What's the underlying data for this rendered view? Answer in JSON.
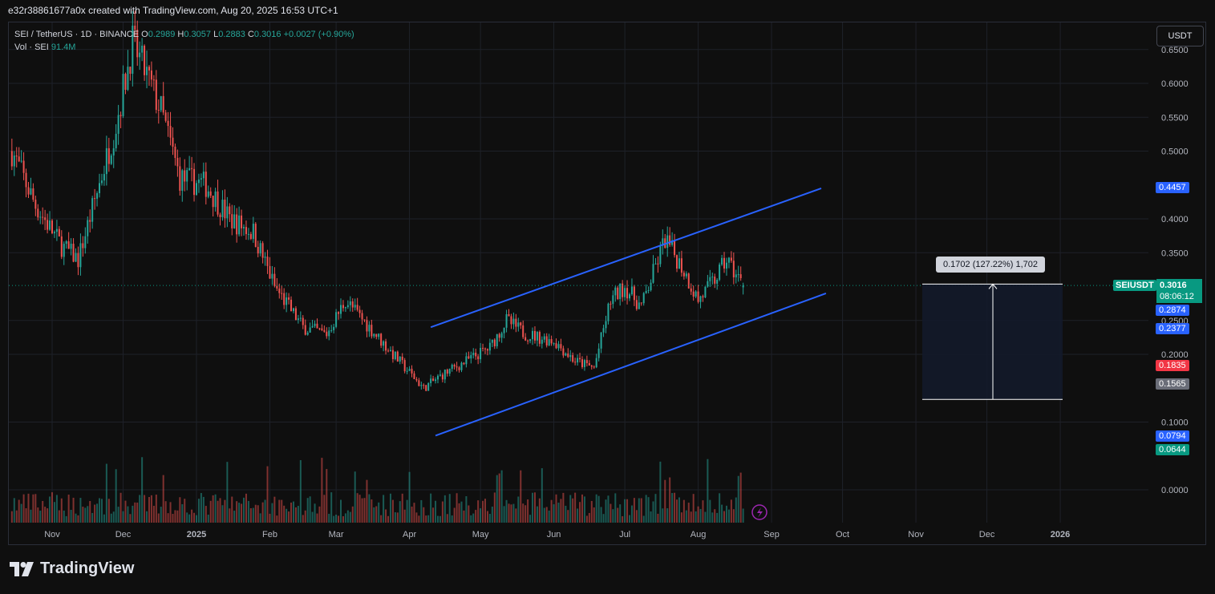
{
  "header": {
    "attribution": "e32r38861677a0x created with TradingView.com, Aug 20, 2025 16:53 UTC+1"
  },
  "legend": {
    "symbol": "SEI / TetherUS · 1D · BINANCE",
    "o_label": "O",
    "o_value": "0.2989",
    "h_label": "H",
    "h_value": "0.3057",
    "l_label": "L",
    "l_value": "0.2883",
    "c_label": "C",
    "c_value": "0.3016",
    "change": "+0.0027 (+0.90%)",
    "vol_label": "Vol · SEI",
    "vol_value": "91.4M"
  },
  "toolbar": {
    "currency": "USDT"
  },
  "price_tags": {
    "symbol": "SEIUSDT",
    "last": "0.3016",
    "countdown": "08:06:12",
    "levels": [
      {
        "value": "0.4457",
        "color": "#2962ff"
      },
      {
        "value": "0.2874",
        "color": "#2962ff"
      },
      {
        "value": "0.2377",
        "color": "#2962ff"
      },
      {
        "value": "0.1835",
        "color": "#f23645"
      },
      {
        "value": "0.1565",
        "color": "#6a6d78"
      },
      {
        "value": "0.0794",
        "color": "#2962ff"
      },
      {
        "value": "0.0644",
        "color": "#089981"
      }
    ]
  },
  "measure": {
    "label": "0.1702 (127.22%) 1,702"
  },
  "footer": {
    "brand": "TradingView"
  },
  "colors": {
    "up": "#26a69a",
    "down": "#ef5350",
    "channel": "#2962ff",
    "last_line": "#089981"
  },
  "chart_data": {
    "type": "candlestick",
    "y_axis_ticks": [
      "0.6500",
      "0.6000",
      "0.5500",
      "0.5000",
      "0.4000",
      "0.3500",
      "0.2500",
      "0.2000",
      "0.1000",
      "0.0000"
    ],
    "x_axis_ticks": [
      "Nov",
      "Dec",
      "2025",
      "Feb",
      "Mar",
      "Apr",
      "May",
      "Jun",
      "Jul",
      "Aug",
      "Sep",
      "Oct",
      "Nov",
      "Dec",
      "2026"
    ],
    "ylim": [
      0.0,
      0.66
    ],
    "series_approx_close": [
      {
        "date": "2024-10-15",
        "close": 0.5
      },
      {
        "date": "2024-10-25",
        "close": 0.42
      },
      {
        "date": "2024-11-05",
        "close": 0.36
      },
      {
        "date": "2024-11-12",
        "close": 0.34
      },
      {
        "date": "2024-11-20",
        "close": 0.44
      },
      {
        "date": "2024-11-28",
        "close": 0.54
      },
      {
        "date": "2024-12-05",
        "close": 0.66
      },
      {
        "date": "2024-12-10",
        "close": 0.62
      },
      {
        "date": "2024-12-17",
        "close": 0.56
      },
      {
        "date": "2024-12-25",
        "close": 0.46
      },
      {
        "date": "2025-01-05",
        "close": 0.45
      },
      {
        "date": "2025-01-15",
        "close": 0.4
      },
      {
        "date": "2025-01-25",
        "close": 0.38
      },
      {
        "date": "2025-02-03",
        "close": 0.3
      },
      {
        "date": "2025-02-15",
        "close": 0.24
      },
      {
        "date": "2025-02-25",
        "close": 0.23
      },
      {
        "date": "2025-03-05",
        "close": 0.28
      },
      {
        "date": "2025-03-15",
        "close": 0.24
      },
      {
        "date": "2025-03-25",
        "close": 0.2
      },
      {
        "date": "2025-04-07",
        "close": 0.15
      },
      {
        "date": "2025-04-15",
        "close": 0.17
      },
      {
        "date": "2025-04-25",
        "close": 0.19
      },
      {
        "date": "2025-05-05",
        "close": 0.21
      },
      {
        "date": "2025-05-12",
        "close": 0.25
      },
      {
        "date": "2025-05-20",
        "close": 0.23
      },
      {
        "date": "2025-06-01",
        "close": 0.22
      },
      {
        "date": "2025-06-10",
        "close": 0.19
      },
      {
        "date": "2025-06-18",
        "close": 0.18
      },
      {
        "date": "2025-06-25",
        "close": 0.28
      },
      {
        "date": "2025-07-01",
        "close": 0.3
      },
      {
        "date": "2025-07-08",
        "close": 0.27
      },
      {
        "date": "2025-07-14",
        "close": 0.33
      },
      {
        "date": "2025-07-18",
        "close": 0.37
      },
      {
        "date": "2025-07-25",
        "close": 0.33
      },
      {
        "date": "2025-08-01",
        "close": 0.28
      },
      {
        "date": "2025-08-08",
        "close": 0.31
      },
      {
        "date": "2025-08-13",
        "close": 0.34
      },
      {
        "date": "2025-08-20",
        "close": 0.3016
      }
    ],
    "channel_upper": [
      {
        "date": "2025-04-10",
        "price": 0.24
      },
      {
        "date": "2025-09-22",
        "price": 0.445
      }
    ],
    "channel_lower": [
      {
        "date": "2025-04-12",
        "price": 0.08
      },
      {
        "date": "2025-09-24",
        "price": 0.29
      }
    ],
    "measurement": {
      "from_price": 0.1335,
      "to_price": 0.3037,
      "change": 0.1702,
      "percent": 127.22
    }
  }
}
